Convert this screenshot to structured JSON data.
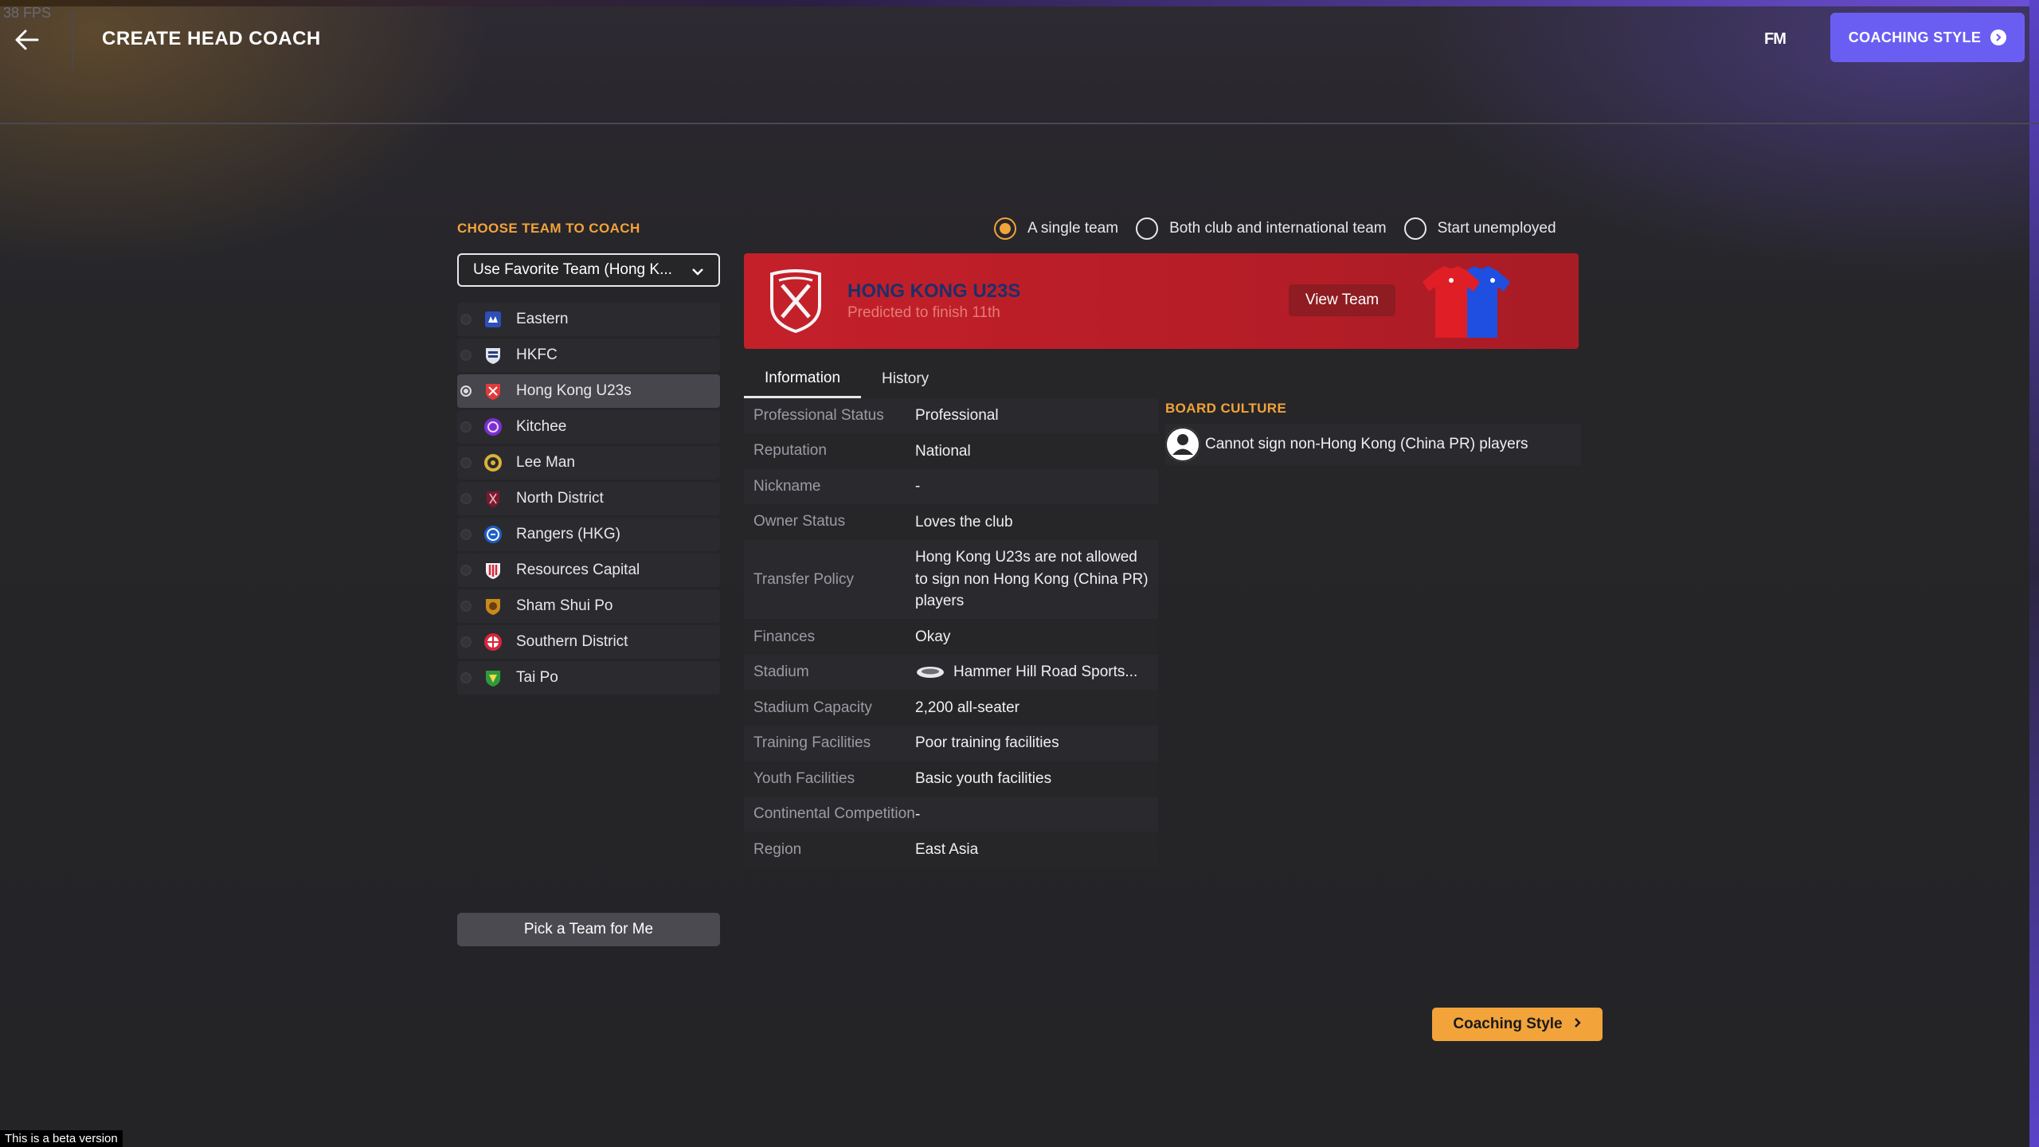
{
  "overlay": {
    "fps": "38 FPS",
    "beta": "This is a beta version"
  },
  "header": {
    "title": "CREATE HEAD COACH",
    "logo": "FM",
    "cta_label": "COACHING STYLE"
  },
  "left": {
    "section_label": "CHOOSE TEAM TO COACH",
    "dropdown_value": "Use Favorite Team (Hong K...",
    "teams": [
      {
        "name": "Eastern",
        "icon": "eastern-crest"
      },
      {
        "name": "HKFC",
        "icon": "hkfc-crest"
      },
      {
        "name": "Hong Kong U23s",
        "icon": "hong-kong-crest",
        "selected": true
      },
      {
        "name": "Kitchee",
        "icon": "kitchee-crest"
      },
      {
        "name": "Lee Man",
        "icon": "lee-man-crest"
      },
      {
        "name": "North District",
        "icon": "north-district-crest"
      },
      {
        "name": "Rangers (HKG)",
        "icon": "rangers-crest"
      },
      {
        "name": "Resources Capital",
        "icon": "resources-capital-crest"
      },
      {
        "name": "Sham Shui Po",
        "icon": "sham-shui-po-crest"
      },
      {
        "name": "Southern District",
        "icon": "southern-district-crest"
      },
      {
        "name": "Tai Po",
        "icon": "tai-po-crest"
      }
    ],
    "pick_button": "Pick a Team for Me"
  },
  "mode_options": [
    {
      "label": "A single team",
      "selected": true
    },
    {
      "label": "Both club and international team",
      "selected": false
    },
    {
      "label": "Start unemployed",
      "selected": false
    }
  ],
  "banner": {
    "team_name": "HONG KONG U23S",
    "prediction": "Predicted to finish 11th",
    "view_button": "View Team",
    "accent_color": "#c4202a"
  },
  "tabs": [
    "Information",
    "History"
  ],
  "info": [
    {
      "key": "Professional Status",
      "value": "Professional"
    },
    {
      "key": "Reputation",
      "value": "National"
    },
    {
      "key": "Nickname",
      "value": "-"
    },
    {
      "key": "Owner Status",
      "value": "Loves the club"
    },
    {
      "key": "Transfer Policy",
      "value": "Hong Kong U23s are not allowed to sign non Hong Kong (China PR) players"
    },
    {
      "key": "Finances",
      "value": "Okay"
    },
    {
      "key": "Stadium",
      "value": "Hammer Hill Road Sports..."
    },
    {
      "key": "Stadium Capacity",
      "value": "2,200 all-seater"
    },
    {
      "key": "Training Facilities",
      "value": "Poor training facilities"
    },
    {
      "key": "Youth Facilities",
      "value": "Basic youth facilities"
    },
    {
      "key": "Continental Competition",
      "value": "-"
    },
    {
      "key": "Region",
      "value": "East Asia"
    }
  ],
  "board": {
    "label": "BOARD CULTURE",
    "rule": "Cannot sign non-Hong Kong (China PR) players"
  },
  "footer": {
    "cta_label": "Coaching Style"
  },
  "colors": {
    "accent_orange": "#f2a33a",
    "accent_purple": "#6a5ef2"
  }
}
